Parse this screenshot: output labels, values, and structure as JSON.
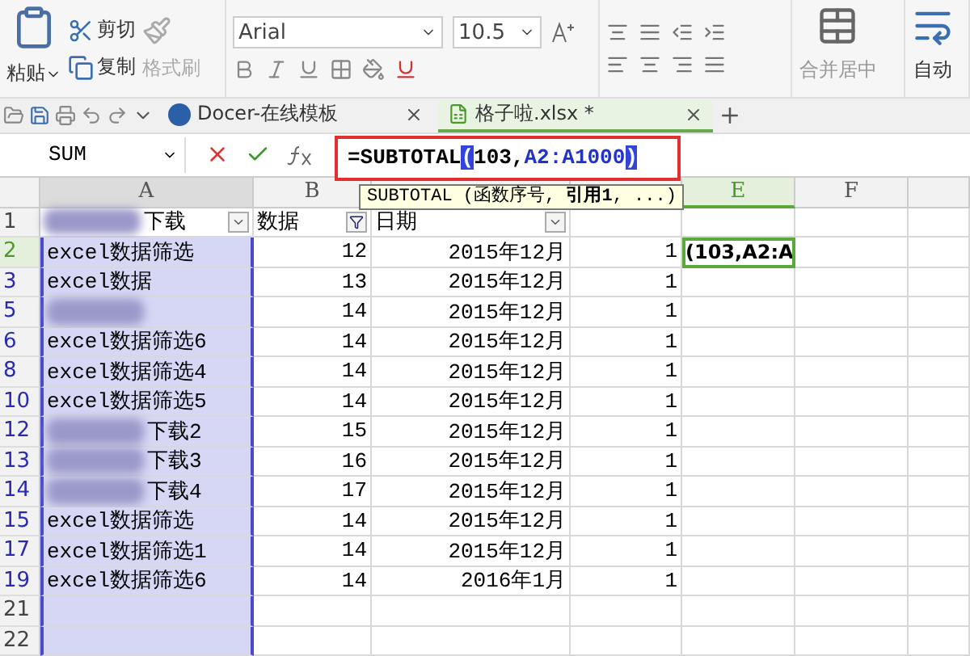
{
  "ribbon": {
    "paste": "粘贴",
    "cut": "剪切",
    "copy": "复制",
    "format_painter": "格式刷",
    "font": "Arial",
    "size": "10.5",
    "merge": "合并居中",
    "wrap": "自动"
  },
  "tabs": [
    {
      "label": "Docer-在线模板",
      "selected": false
    },
    {
      "label": "格子啦.xlsx *",
      "selected": true
    }
  ],
  "formula_bar": {
    "name_box": "SUM",
    "formula": [
      {
        "text": "=SUBTOTAL",
        "kind": "plain"
      },
      {
        "text": "(",
        "kind": "paren"
      },
      {
        "text": "103,",
        "kind": "plain"
      },
      {
        "text": "A2:A1000",
        "kind": "ref"
      },
      {
        "text": ")",
        "kind": "paren"
      }
    ]
  },
  "tooltip": "SUBTOTAL (函数序号, **引用1**, ...)",
  "columns": [
    {
      "label": "A",
      "selected": true,
      "active": false
    },
    {
      "label": "B",
      "selected": false,
      "active": false
    },
    {
      "label": "E",
      "selected": false,
      "active": true
    },
    {
      "label": "F",
      "selected": false,
      "active": false
    }
  ],
  "rows": [
    {
      "number": "1",
      "filtered": false,
      "active": false,
      "cells": {
        "a": {
          "text": "下载",
          "redacted": true,
          "filter_applied": false
        },
        "b": {
          "text": "数据",
          "filter_applied": true
        },
        "c": {
          "text": "日期",
          "filter_applied": false
        }
      }
    },
    {
      "number": "2",
      "filtered": true,
      "active": true,
      "cells": {
        "a": {
          "text": "excel数据筛选",
          "selected": true
        },
        "b": {
          "text": "12"
        },
        "c": {
          "text": "2015年12月"
        },
        "d": {
          "text": "1"
        },
        "e": {
          "text": "(103,A2:A",
          "editing": true
        }
      }
    },
    {
      "number": "3",
      "filtered": true,
      "active": false,
      "cells": {
        "a": {
          "text": "excel数据",
          "selected": true
        },
        "b": {
          "text": "13"
        },
        "c": {
          "text": "2015年12月"
        },
        "d": {
          "text": "1"
        }
      }
    },
    {
      "number": "5",
      "filtered": true,
      "active": false,
      "cells": {
        "a": {
          "redacted": true,
          "selected": true
        },
        "b": {
          "text": "14"
        },
        "c": {
          "text": "2015年12月"
        },
        "d": {
          "text": "1"
        }
      }
    },
    {
      "number": "6",
      "filtered": true,
      "active": false,
      "cells": {
        "a": {
          "text": "excel数据筛选6",
          "selected": true
        },
        "b": {
          "text": "14"
        },
        "c": {
          "text": "2015年12月"
        },
        "d": {
          "text": "1"
        }
      }
    },
    {
      "number": "8",
      "filtered": true,
      "active": false,
      "cells": {
        "a": {
          "text": "excel数据筛选4",
          "selected": true
        },
        "b": {
          "text": "14"
        },
        "c": {
          "text": "2015年12月"
        },
        "d": {
          "text": "1"
        }
      }
    },
    {
      "number": "10",
      "filtered": true,
      "active": false,
      "cells": {
        "a": {
          "text": "excel数据筛选5",
          "selected": true
        },
        "b": {
          "text": "14"
        },
        "c": {
          "text": "2015年12月"
        },
        "d": {
          "text": "1"
        }
      }
    },
    {
      "number": "12",
      "filtered": true,
      "active": false,
      "cells": {
        "a": {
          "text": "下载2",
          "redacted": true,
          "selected": true
        },
        "b": {
          "text": "15"
        },
        "c": {
          "text": "2015年12月"
        },
        "d": {
          "text": "1"
        }
      }
    },
    {
      "number": "13",
      "filtered": true,
      "active": false,
      "cells": {
        "a": {
          "text": "下载3",
          "redacted": true,
          "selected": true
        },
        "b": {
          "text": "16"
        },
        "c": {
          "text": "2015年12月"
        },
        "d": {
          "text": "1"
        }
      }
    },
    {
      "number": "14",
      "filtered": true,
      "active": false,
      "cells": {
        "a": {
          "text": "下载4",
          "redacted": true,
          "selected": true
        },
        "b": {
          "text": "17"
        },
        "c": {
          "text": "2015年12月"
        },
        "d": {
          "text": "1"
        }
      }
    },
    {
      "number": "15",
      "filtered": true,
      "active": false,
      "cells": {
        "a": {
          "text": "excel数据筛选",
          "selected": true
        },
        "b": {
          "text": "14"
        },
        "c": {
          "text": "2015年12月"
        },
        "d": {
          "text": "1"
        }
      }
    },
    {
      "number": "17",
      "filtered": true,
      "active": false,
      "cells": {
        "a": {
          "text": "excel数据筛选1",
          "selected": true
        },
        "b": {
          "text": "14"
        },
        "c": {
          "text": "2015年12月"
        },
        "d": {
          "text": "1"
        }
      }
    },
    {
      "number": "19",
      "filtered": true,
      "active": false,
      "cells": {
        "a": {
          "text": "excel数据筛选6",
          "selected": true
        },
        "b": {
          "text": "14"
        },
        "c": {
          "text": "2016年1月"
        },
        "d": {
          "text": "1"
        }
      }
    },
    {
      "number": "21",
      "filtered": false,
      "active": false,
      "cells": {
        "a": {
          "selected": true
        }
      }
    },
    {
      "number": "22",
      "filtered": false,
      "active": false,
      "cells": {
        "a": {
          "selected": true
        }
      }
    }
  ]
}
